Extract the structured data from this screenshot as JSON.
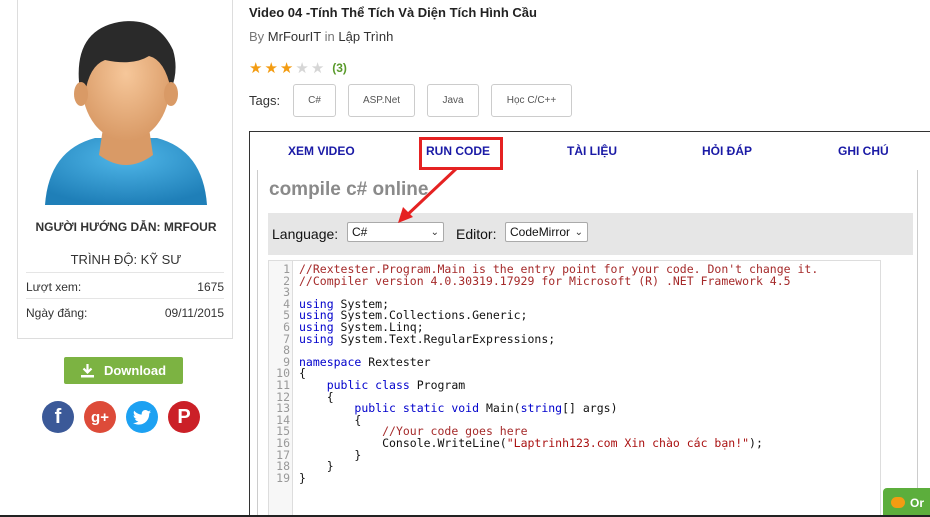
{
  "video": {
    "title": "Video 04 -Tính Thể Tích Và Diện Tích Hình Cầu",
    "by_label": "By",
    "author": "MrFourIT",
    "in_label": "in",
    "category": "Lập Trình",
    "rating": {
      "stars_on": 3,
      "stars_total": 5,
      "count_text": "(3)"
    },
    "tags_label": "Tags:",
    "tags": [
      "C#",
      "ASP.Net",
      "Java",
      "Học C/C++"
    ]
  },
  "profile": {
    "name": "NGƯỜI HƯỚNG DẪN: MRFOUR",
    "level": "TRÌNH ĐỘ: KỸ SƯ",
    "views_label": "Lượt xem:",
    "views_value": "1675",
    "date_label": "Ngày đăng:",
    "date_value": "09/11/2015",
    "download_label": "Download",
    "social": [
      "facebook-icon",
      "google-plus-icon",
      "twitter-icon",
      "pinterest-icon"
    ],
    "fb_glyph": "f",
    "gp_glyph": "g+",
    "pi_glyph": "P"
  },
  "tabs": [
    "XEM VIDEO",
    "RUN CODE",
    "TÀI LIỆU",
    "HỎI ĐÁP",
    "GHI CHÚ"
  ],
  "compiler": {
    "title": "compile c# online",
    "language_label": "Language:",
    "language_value": "C#",
    "editor_label": "Editor:",
    "editor_value": "CodeMirror"
  },
  "code_lines": [
    {
      "n": "1",
      "parts": [
        [
          "c-com",
          "//Rextester.Program.Main is the entry point for your code. Don't change it."
        ]
      ]
    },
    {
      "n": "2",
      "parts": [
        [
          "c-com",
          "//Compiler version 4.0.30319.17929 for Microsoft (R) .NET Framework 4.5"
        ]
      ]
    },
    {
      "n": "3",
      "parts": []
    },
    {
      "n": "4",
      "parts": [
        [
          "c-kw",
          "using"
        ],
        [
          "c-txt",
          " System;"
        ]
      ]
    },
    {
      "n": "5",
      "parts": [
        [
          "c-kw",
          "using"
        ],
        [
          "c-txt",
          " System.Collections.Generic;"
        ]
      ]
    },
    {
      "n": "6",
      "parts": [
        [
          "c-kw",
          "using"
        ],
        [
          "c-txt",
          " System.Linq;"
        ]
      ]
    },
    {
      "n": "7",
      "parts": [
        [
          "c-kw",
          "using"
        ],
        [
          "c-txt",
          " System.Text.RegularExpressions;"
        ]
      ]
    },
    {
      "n": "8",
      "parts": []
    },
    {
      "n": "9",
      "parts": [
        [
          "c-kw",
          "namespace"
        ],
        [
          "c-txt",
          " Rextester"
        ]
      ]
    },
    {
      "n": "10",
      "parts": [
        [
          "c-txt",
          "{"
        ]
      ]
    },
    {
      "n": "11",
      "parts": [
        [
          "c-txt",
          "    "
        ],
        [
          "c-kw",
          "public class"
        ],
        [
          "c-txt",
          " Program"
        ]
      ]
    },
    {
      "n": "12",
      "parts": [
        [
          "c-txt",
          "    {"
        ]
      ]
    },
    {
      "n": "13",
      "parts": [
        [
          "c-txt",
          "        "
        ],
        [
          "c-kw",
          "public static void"
        ],
        [
          "c-txt",
          " Main("
        ],
        [
          "c-kw",
          "string"
        ],
        [
          "c-txt",
          "[] args)"
        ]
      ]
    },
    {
      "n": "14",
      "parts": [
        [
          "c-txt",
          "        {"
        ]
      ]
    },
    {
      "n": "15",
      "parts": [
        [
          "c-txt",
          "            "
        ],
        [
          "c-com",
          "//Your code goes here"
        ]
      ]
    },
    {
      "n": "16",
      "parts": [
        [
          "c-txt",
          "            Console.WriteLine("
        ],
        [
          "c-str",
          "\"Laptrinh123.com Xin chào các bạn!\""
        ],
        [
          "c-txt",
          ");"
        ]
      ]
    },
    {
      "n": "17",
      "parts": [
        [
          "c-txt",
          "        }"
        ]
      ]
    },
    {
      "n": "18",
      "parts": [
        [
          "c-txt",
          "    }"
        ]
      ]
    },
    {
      "n": "19",
      "parts": [
        [
          "c-txt",
          "}"
        ]
      ]
    }
  ],
  "chat": {
    "label": "Or"
  },
  "colors": {
    "accent_green": "#7cb342",
    "tab_blue": "#1a1aa6",
    "highlight_red": "#e52222",
    "star": "#f39c12"
  }
}
